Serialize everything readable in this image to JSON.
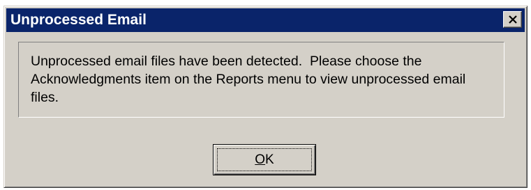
{
  "window": {
    "title": "Unprocessed Email",
    "close_icon": "close-icon"
  },
  "message": {
    "text": "Unprocessed email files have been detected.  Please choose the\nAcknowledgments item on the Reports menu to view unprocessed email\nfiles."
  },
  "buttons": {
    "ok": {
      "mnemonic": "O",
      "rest": "K"
    }
  },
  "colors": {
    "titlebar": "#0a246a",
    "title_text": "#ffffff",
    "face": "#d4d0c8"
  }
}
